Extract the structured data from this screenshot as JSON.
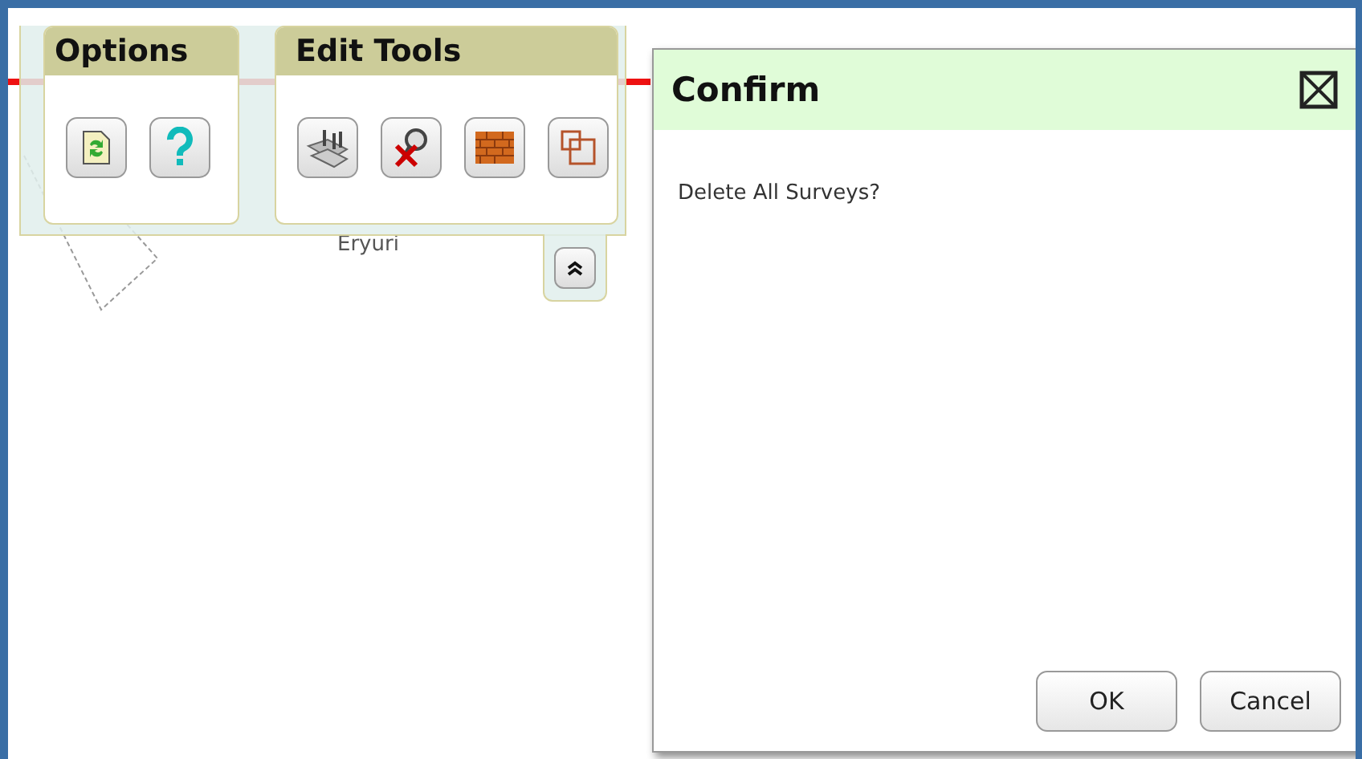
{
  "toolbar": {
    "groups": [
      {
        "title": "Options",
        "tools": [
          {
            "kind": "refresh"
          },
          {
            "kind": "help"
          }
        ]
      },
      {
        "title": "Edit Tools",
        "tools": [
          {
            "kind": "survey"
          },
          {
            "kind": "delete"
          },
          {
            "kind": "wall"
          },
          {
            "kind": "frame"
          }
        ]
      }
    ]
  },
  "map": {
    "labels": [
      "Eryuri"
    ]
  },
  "dialog": {
    "title": "Confirm",
    "message": "Delete All Surveys?",
    "buttons": [
      "OK",
      "Cancel"
    ]
  }
}
